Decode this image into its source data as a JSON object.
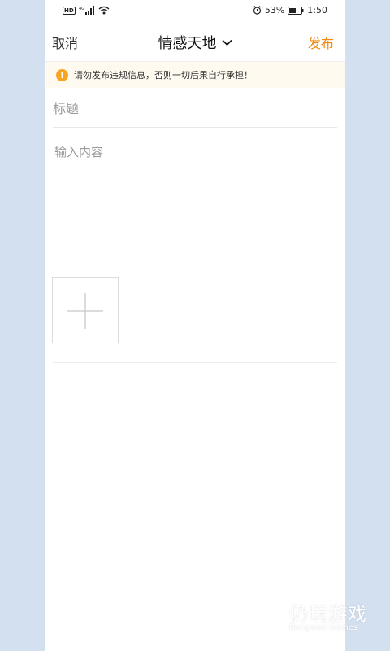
{
  "status_bar": {
    "network_badge": "HD",
    "signal_type": "4G",
    "battery_percent": "53%",
    "time": "1:50",
    "icons": [
      "hd-icon",
      "signal-icon",
      "wifi-icon",
      "alarm-icon",
      "battery-icon"
    ]
  },
  "header": {
    "cancel_label": "取消",
    "title": "情感天地",
    "publish_label": "发布"
  },
  "warning": {
    "text": "请勿发布违规信息，否则一切后果自行承担！"
  },
  "form": {
    "title_placeholder": "标题",
    "content_placeholder": "输入内容"
  },
  "watermark": {
    "name": "仍玩游戏",
    "subtitle": "Rengwan Games"
  },
  "colors": {
    "accent": "#f08a12",
    "warning_icon": "#f5a623",
    "page_background": "#d3e0f0"
  }
}
